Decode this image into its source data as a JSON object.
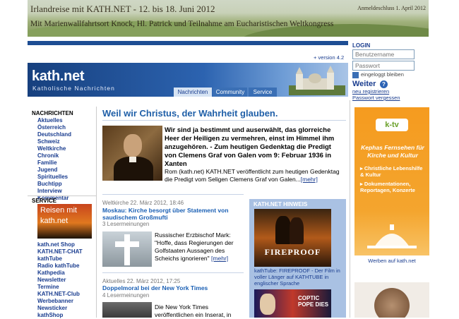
{
  "banner": {
    "line1": "Irlandreise mit KATH.NET - 12. bis 18. Juni 2012",
    "line2": "Mit Marienwallfahrtsort Knock, Hl. Patrick und Teilnahme am Eucharistischen Weltkongress",
    "deadline": "Anmeldeschluss 1. April 2012"
  },
  "version": "+ version 4.2",
  "header": {
    "logo": "kath.net",
    "subtitle": "Katholische Nachrichten",
    "tabs": [
      "Nachrichten",
      "Community",
      "Service"
    ]
  },
  "login": {
    "heading": "LOGIN",
    "username_placeholder": "Benutzername",
    "password_placeholder": "Passwort",
    "remember": "eingeloggt bleiben",
    "submit": "Weiter",
    "help": "?",
    "register": "neu registrieren",
    "forgot": "Passwort vergessen"
  },
  "sidebar": {
    "news_heading": "NACHRICHTEN",
    "news_items": [
      "Aktuelles",
      "Österreich",
      "Deutschland",
      "Schweiz",
      "Weltkirche",
      "Chronik",
      "Familie",
      "Jugend",
      "Spirituelles",
      "Buchtipp",
      "Interview",
      "Kommentar"
    ],
    "service_heading": "SERVICE",
    "reisen": "Reisen mit kath.net",
    "service_items": [
      "kath.net Shop",
      "KATH.NET-CHAT",
      "kathTube",
      "Radio kathTube",
      "Kathpedia",
      "Newsletter",
      "Termine",
      "KATH.NET-Club",
      "Werbebanner",
      "Newsticker",
      "kathShop"
    ]
  },
  "main": {
    "headline": "Weil wir Christus, der Wahrheit glauben.",
    "lead": "Wir sind ja bestimmt und auserwählt, das glorreiche Heer der Heiligen zu vermehren, einst im Himmel ihm anzugehören. - Zum heutigen Gedenktag die Predigt von Clemens Graf von Galen vom 9: Februar 1936 in Xanten",
    "lead_body": "Rom (kath.net) KATH.NET veröffentlicht zum heutigen Gedenktag die Predigt vom Seligen Clemens Graf von Galen...",
    "mehr": "[mehr]",
    "articles": [
      {
        "meta": "Weltkirche 22. März 2012, 18:46",
        "title": "Moskau: Kirche besorgt über Statement von saudischem Großmufti",
        "comments": "3 Lesermeinungen",
        "excerpt": "Russischer Erzbischof Mark: \"Hoffe, dass Regierungen der Golfstaaten Aussagen des Scheichs ignorieren\"",
        "mehr": "[mehr]"
      },
      {
        "meta": "Aktuelles 22. März 2012, 17:25",
        "title": "Doppelmoral bei der New York Times",
        "comments": "4 Lesermeinungen",
        "excerpt": "Die New York Times veröffentlichen ein Inserat, in"
      }
    ]
  },
  "hinweis": {
    "heading": "KATH.NET HINWEIS",
    "poster_title": "FIREPROOF",
    "text": "kathTube: FIREPROOF - Der Film in voller Länger auf KATHTUBE in englischer Sprache",
    "coptic": "COPTIC POPE DIES"
  },
  "ad": {
    "logo": "k-tv",
    "heading": "Kephas Fernsehen für Kirche und Kultur",
    "bullets": [
      "Christliche Lebenshilfe & Kultur",
      "Dokumentationen, Reportagen, Konzerte"
    ],
    "werben": "Werben auf kath.net"
  },
  "colors": {
    "brand_blue": "#1d4d93",
    "link_blue": "#1a3d8f",
    "ad_orange": "#f59b1f"
  }
}
